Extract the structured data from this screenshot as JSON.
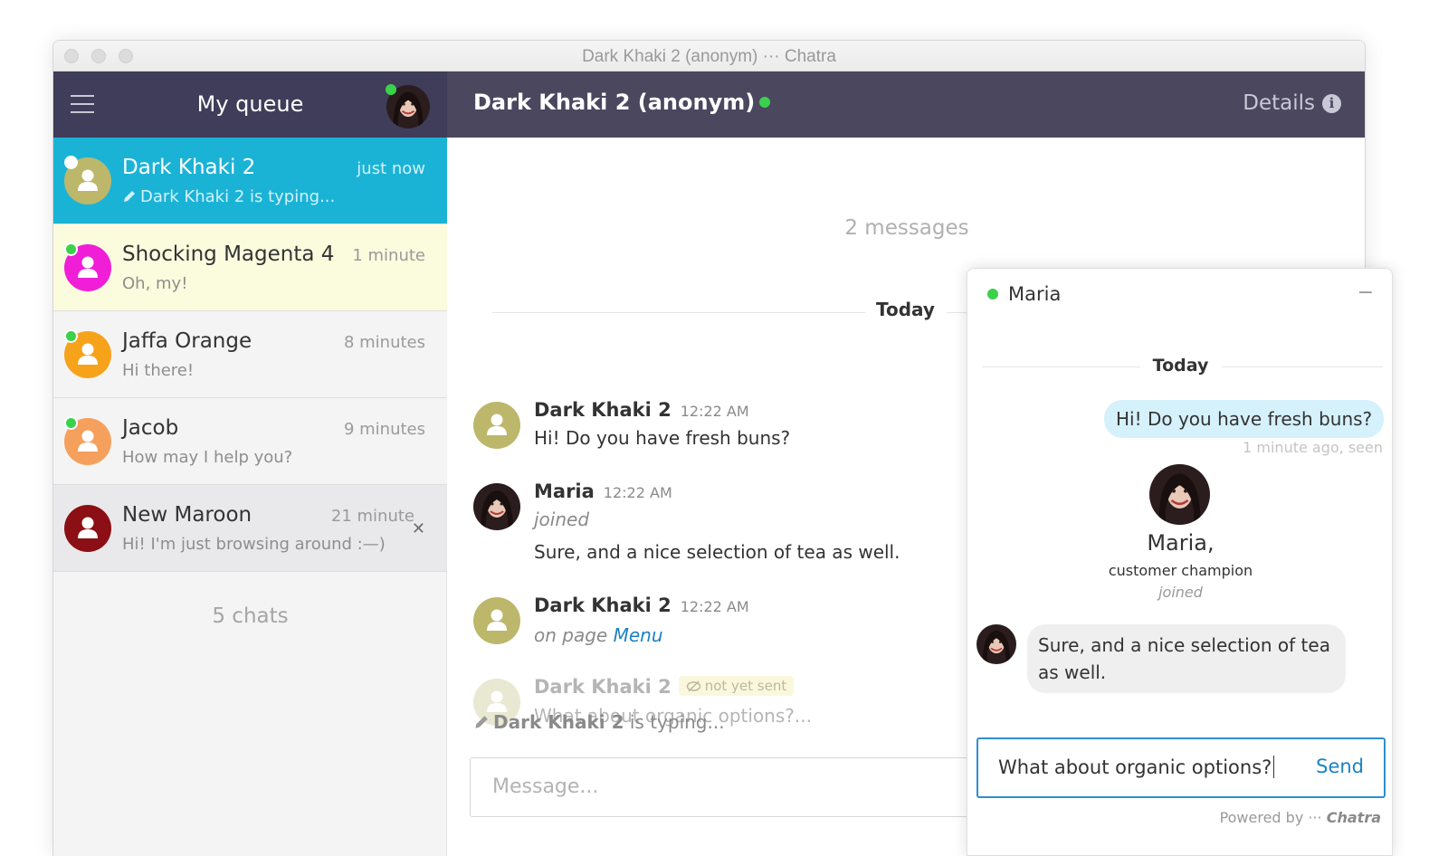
{
  "window": {
    "title": "Dark Khaki 2 (anonym) ··· Chatra"
  },
  "sidebar": {
    "title": "My queue",
    "chats_count": "5 chats",
    "items": [
      {
        "name": "Dark Khaki 2",
        "time": "just now",
        "preview": "Dark Khaki 2 is typing...",
        "avatar_color": "#bdb76b",
        "bg": "#1ab3d6",
        "dot_color": "#ffffff"
      },
      {
        "name": "Shocking Magenta 4",
        "time": "1 minute",
        "preview": "Oh, my!",
        "avatar_color": "#f01ed6",
        "bg": "#fbfbde",
        "dot_color": "#3ad14b"
      },
      {
        "name": "Jaffa Orange",
        "time": "8 minutes",
        "preview": "Hi there!",
        "avatar_color": "#f7a21b",
        "bg": "#f4f4f4",
        "dot_color": "#3ad14b"
      },
      {
        "name": "Jacob",
        "time": "9 minutes",
        "preview": "How may I help you?",
        "avatar_color": "#f6a05e",
        "bg": "#f4f4f4",
        "dot_color": "#3ad14b"
      },
      {
        "name": "New Maroon",
        "time": "21 minute",
        "preview": "Hi! I'm just browsing around :—)",
        "avatar_color": "#8b0f14",
        "bg": "#e9e9eb",
        "dot_color": ""
      }
    ]
  },
  "chat": {
    "title": "Dark Khaki 2 (anonym)",
    "details_label": "Details",
    "message_count": "2 messages",
    "today": "Today",
    "messages": [
      {
        "name": "Dark Khaki 2",
        "time": "12:22 AM",
        "text": "Hi! Do you have fresh buns?"
      },
      {
        "name": "Maria",
        "time": "12:22 AM",
        "note": "joined",
        "text": "Sure, and a nice selection of tea as well."
      },
      {
        "name": "Dark Khaki 2",
        "time": "12:22 AM",
        "note_prefix": "on page",
        "link": "Menu"
      },
      {
        "name": "Dark Khaki 2",
        "status": "not yet sent",
        "text": "What about organic options?..."
      }
    ],
    "typing_name": "Dark Khaki 2",
    "typing_suffix": "is typing...",
    "input_placeholder": "Message..."
  },
  "widget": {
    "agent_name": "Maria",
    "minimize": "−",
    "today": "Today",
    "user_message": "Hi! Do you have fresh buns?",
    "seen_status": "1 minute ago, seen",
    "agent_display": "Maria,",
    "agent_role": "customer champion",
    "joined": "joined",
    "agent_message": "Sure, and a nice selection of tea as well.",
    "input_value": "What about organic options?",
    "send_label": "Send",
    "powered_prefix": "Powered by ···",
    "powered_brand": "Chatra"
  },
  "colors": {
    "header_sidebar": "#3f3d59",
    "header_chat": "#4b475f",
    "selected": "#1ab3d6",
    "online": "#3ad14b",
    "link": "#1b82c4"
  },
  "icons": [
    "menu-icon",
    "info-icon",
    "pencil-icon",
    "eye-slash-icon",
    "close-icon",
    "user-icon"
  ]
}
